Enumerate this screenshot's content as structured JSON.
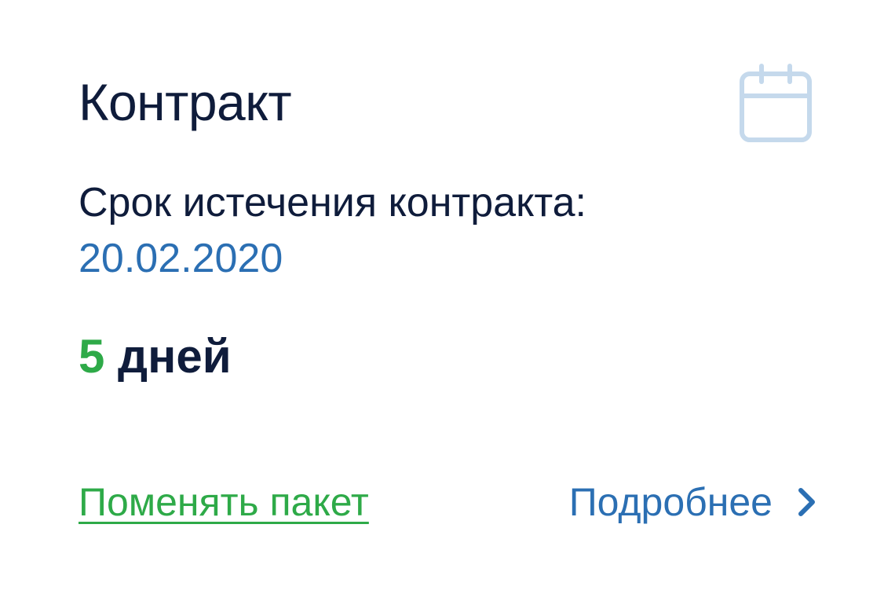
{
  "card": {
    "title": "Контракт",
    "expiry_label": "Срок истечения контракта:",
    "expiry_date": "20.02.2020",
    "days_number": "5",
    "days_unit": "дней",
    "change_package_label": "Поменять пакет",
    "details_label": "Подробнее"
  },
  "icons": {
    "calendar": "calendar-icon",
    "chevron": "chevron-right-icon"
  },
  "colors": {
    "text_dark": "#0f1c3b",
    "accent_blue": "#2b6fb3",
    "accent_green": "#2eaa48",
    "icon_light_blue": "#c5d9ec"
  }
}
